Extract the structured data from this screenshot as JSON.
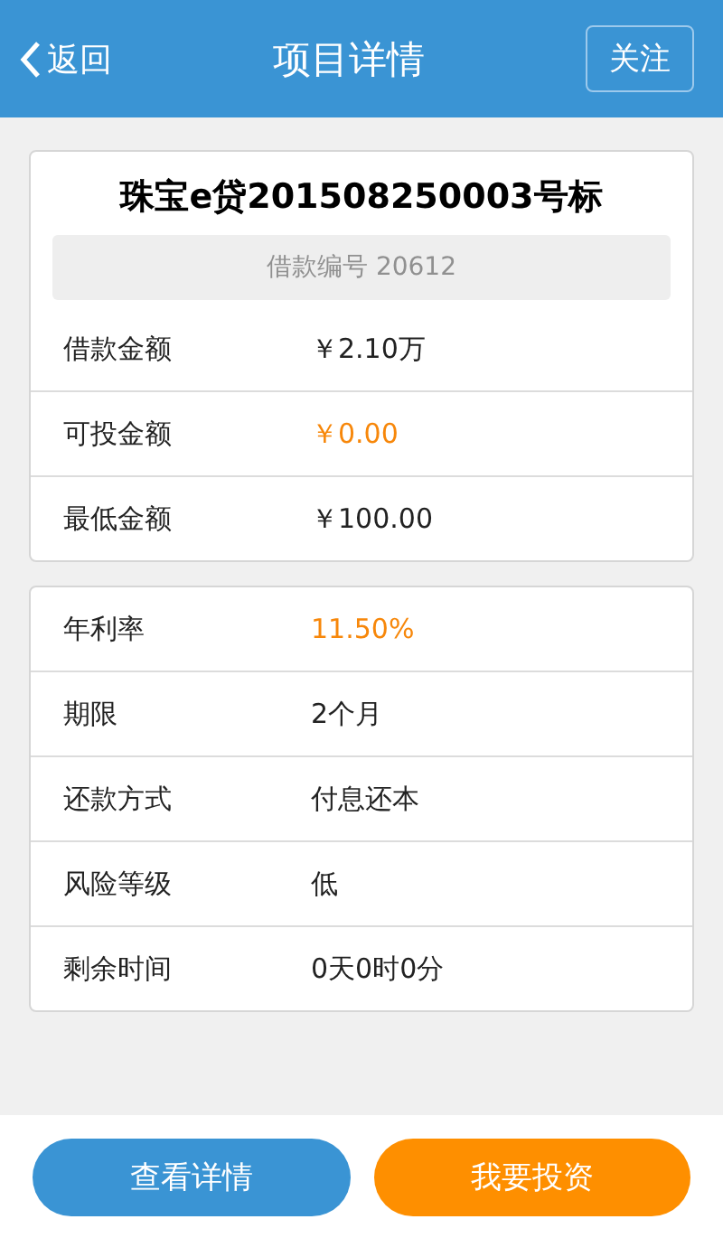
{
  "header": {
    "back": "返回",
    "title": "项目详情",
    "follow": "关注"
  },
  "summary": {
    "title": "珠宝e贷201508250003号标",
    "loan_number": "借款编号 20612",
    "rows": [
      {
        "label": "借款金额",
        "value": "￥2.10万",
        "highlight": false
      },
      {
        "label": "可投金额",
        "value": "￥0.00",
        "highlight": true
      },
      {
        "label": "最低金额",
        "value": "￥100.00",
        "highlight": false
      }
    ]
  },
  "details": {
    "rows": [
      {
        "label": "年利率",
        "value": "11.50%",
        "highlight": true
      },
      {
        "label": "期限",
        "value": "2个月",
        "highlight": false
      },
      {
        "label": "还款方式",
        "value": "付息还本",
        "highlight": false
      },
      {
        "label": "风险等级",
        "value": "低",
        "highlight": false
      },
      {
        "label": "剩余时间",
        "value": "0天0时0分",
        "highlight": false
      }
    ]
  },
  "actions": [
    {
      "label": "查看详情",
      "kind": "secondary"
    },
    {
      "label": "我要投资",
      "kind": "primary"
    }
  ]
}
